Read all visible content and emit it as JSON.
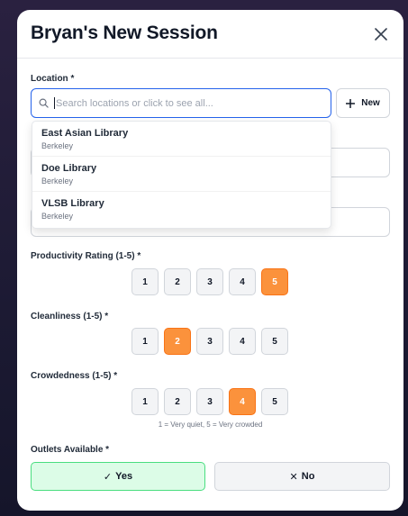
{
  "title": "Bryan's New Session",
  "location": {
    "label": "Location *",
    "placeholder": "Search locations or click to see all...",
    "new_label": "New",
    "options": [
      {
        "name": "East Asian Library",
        "city": "Berkeley"
      },
      {
        "name": "Doe Library",
        "city": "Berkeley"
      },
      {
        "name": "VLSB Library",
        "city": "Berkeley"
      }
    ]
  },
  "productivity": {
    "label": "Productivity Rating (1-5) *",
    "values": [
      "1",
      "2",
      "3",
      "4",
      "5"
    ],
    "selected": 5
  },
  "cleanliness": {
    "label": "Cleanliness (1-5) *",
    "values": [
      "1",
      "2",
      "3",
      "4",
      "5"
    ],
    "selected": 2
  },
  "crowdedness": {
    "label": "Crowdedness (1-5) *",
    "values": [
      "1",
      "2",
      "3",
      "4",
      "5"
    ],
    "selected": 4,
    "hint": "1 = Very quiet, 5 = Very crowded"
  },
  "outlets": {
    "label": "Outlets Available *",
    "yes_label": "Yes",
    "no_label": "No",
    "yes_icon": "✓",
    "no_icon": "✕"
  },
  "colors": {
    "accent": "#fb923c",
    "focus": "#2563eb",
    "yes_bg": "#dcfce7"
  }
}
